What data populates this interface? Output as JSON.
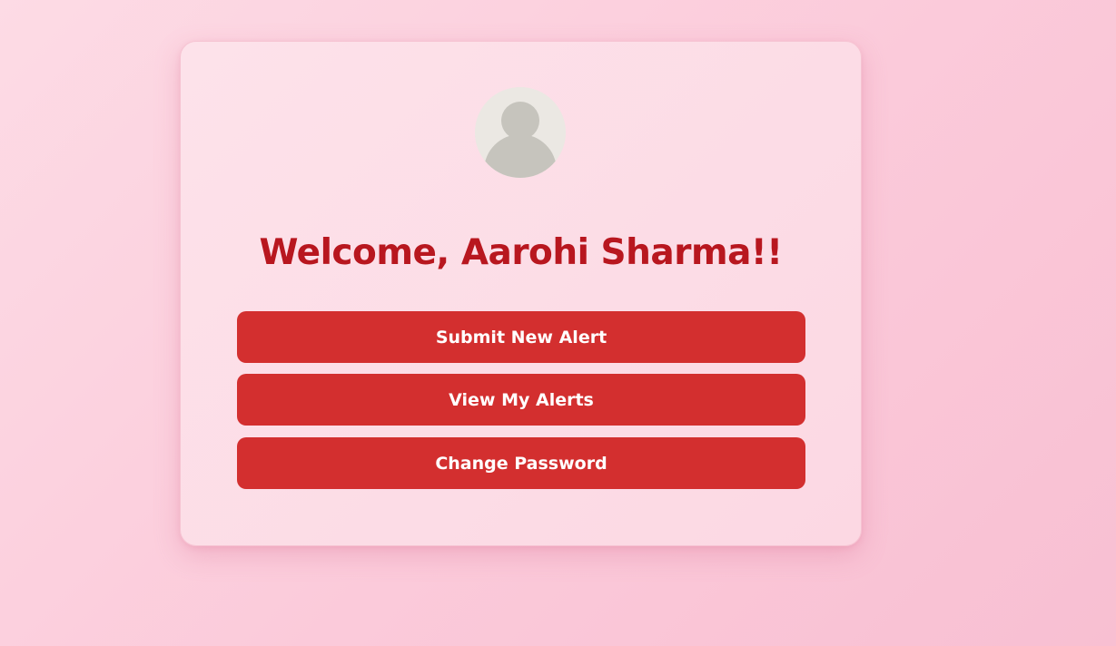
{
  "welcome": {
    "title": "Welcome, Aarohi Sharma!!"
  },
  "avatar": {
    "icon": "user-avatar-icon"
  },
  "actions": {
    "submit_new_alert": "Submit New Alert",
    "view_my_alerts": "View My Alerts",
    "change_password": "Change Password"
  },
  "colors": {
    "accent": "#d32f2f",
    "title": "#b8171f",
    "card": "#fcdce6",
    "background": "#fbcada"
  }
}
